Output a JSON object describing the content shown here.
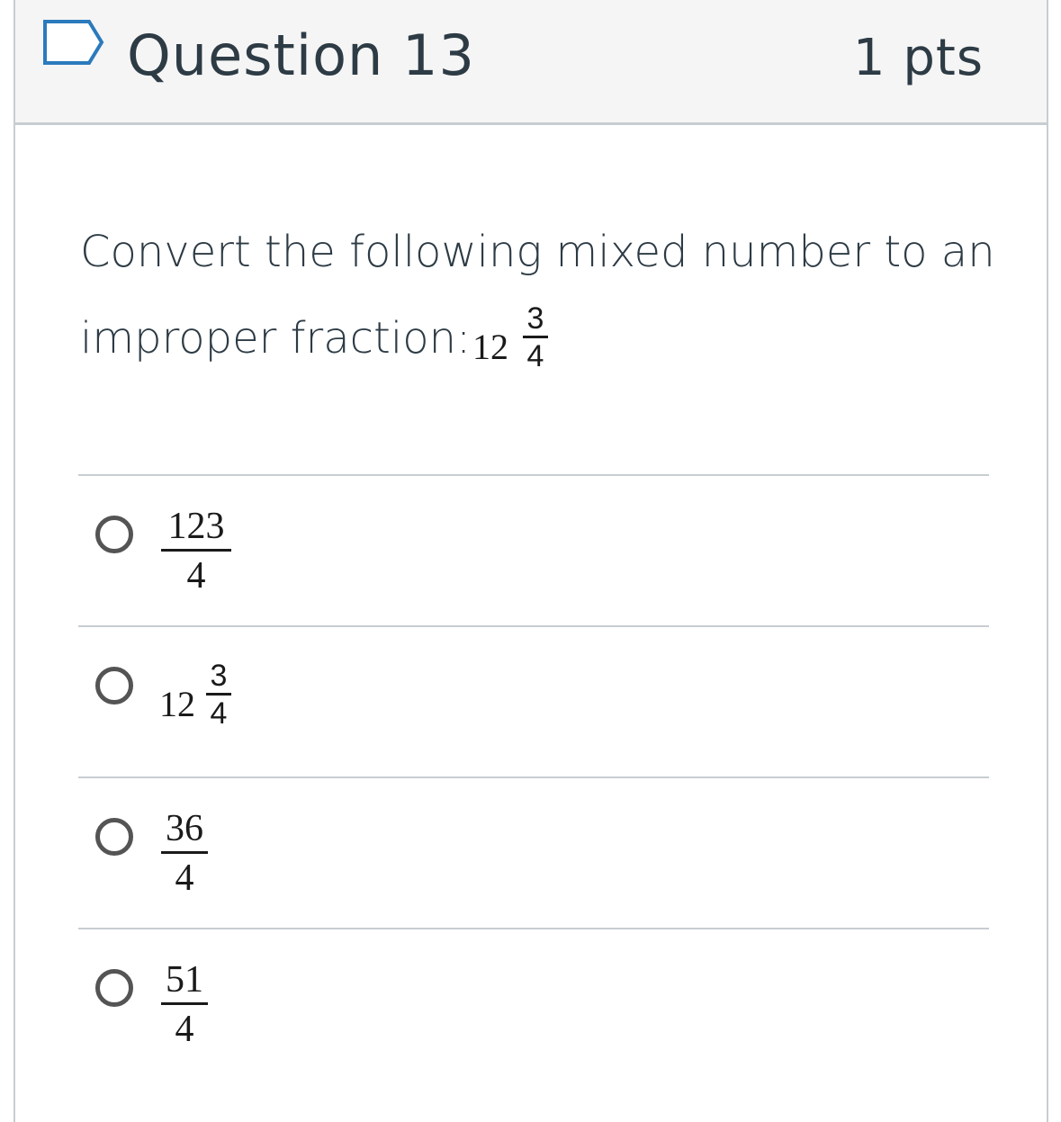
{
  "question": {
    "title": "Question 13",
    "points": "1 pts",
    "prompt_line1": "Convert the following mixed number to an",
    "prompt_line2": "improper fraction:",
    "prompt_math": {
      "whole": "12",
      "numerator": "3",
      "denominator": "4"
    }
  },
  "answers": [
    {
      "type": "fraction",
      "numerator": "123",
      "denominator": "4"
    },
    {
      "type": "mixed",
      "whole": "12",
      "numerator": "3",
      "denominator": "4"
    },
    {
      "type": "fraction",
      "numerator": "36",
      "denominator": "4"
    },
    {
      "type": "fraction",
      "numerator": "51",
      "denominator": "4"
    }
  ],
  "icons": {
    "flag": "bookmark-flag-icon",
    "radio": "radio-button-icon"
  },
  "colors": {
    "flag_outline": "#2b7abc",
    "text": "#2d3b45",
    "border": "#c7cdd1"
  }
}
